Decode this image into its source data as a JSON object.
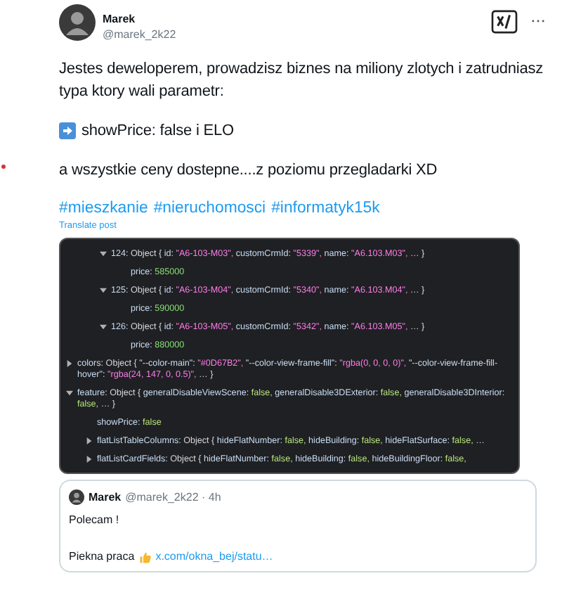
{
  "post": {
    "author": {
      "name": "Marek",
      "handle": "@marek_2k22"
    },
    "paragraphs": [
      {
        "kind": "text",
        "text": "Jestes deweloperem, prowadzisz biznes na miliony zlotych i zatrudniasz typa ktory wali parametr:"
      },
      {
        "kind": "arrow",
        "text": "showPrice: false i ELO"
      },
      {
        "kind": "text",
        "text": "a wszystkie ceny dostepne....z poziomu przegladarki XD"
      }
    ],
    "hashtags": [
      "#mieszkanie",
      "#nieruchomosci",
      "#informatyk15k"
    ],
    "translate": "Translate post",
    "devtools": {
      "array_items": [
        {
          "kind": "object",
          "expanded": true,
          "segments": [
            {
              "kind": "key",
              "text": "124:"
            },
            {
              "kind": "punct",
              "text": "Object {"
            },
            {
              "kind": "key",
              "text": "id:"
            },
            {
              "kind": "string",
              "text": "\"A6-103-M03\","
            },
            {
              "kind": "key",
              "text": "customCrmId:"
            },
            {
              "kind": "string",
              "text": "\"5339\","
            },
            {
              "kind": "key",
              "text": "name:"
            },
            {
              "kind": "string",
              "text": "\"A6.103.M03\","
            },
            {
              "kind": "punct",
              "text": "… }"
            }
          ],
          "children": [
            {
              "kind": "value",
              "segments": [
                {
                  "kind": "key",
                  "text": "price:"
                },
                {
                  "kind": "number",
                  "text": "585000"
                }
              ]
            }
          ]
        },
        {
          "kind": "object",
          "expanded": true,
          "segments": [
            {
              "kind": "key",
              "text": "125:"
            },
            {
              "kind": "punct",
              "text": "Object {"
            },
            {
              "kind": "key",
              "text": "id:"
            },
            {
              "kind": "string",
              "text": "\"A6-103-M04\","
            },
            {
              "kind": "key",
              "text": "customCrmId:"
            },
            {
              "kind": "string",
              "text": "\"5340\","
            },
            {
              "kind": "key",
              "text": "name:"
            },
            {
              "kind": "string",
              "text": "\"A6.103.M04\","
            },
            {
              "kind": "punct",
              "text": "… }"
            }
          ],
          "children": [
            {
              "kind": "value",
              "segments": [
                {
                  "kind": "key",
                  "text": "price:"
                },
                {
                  "kind": "number",
                  "text": "590000"
                }
              ]
            }
          ]
        },
        {
          "kind": "object",
          "expanded": true,
          "segments": [
            {
              "kind": "key",
              "text": "126:"
            },
            {
              "kind": "punct",
              "text": "Object {"
            },
            {
              "kind": "key",
              "text": "id:"
            },
            {
              "kind": "string",
              "text": "\"A6-103-M05\","
            },
            {
              "kind": "key",
              "text": "customCrmId:"
            },
            {
              "kind": "string",
              "text": "\"5342\","
            },
            {
              "kind": "key",
              "text": "name:"
            },
            {
              "kind": "string",
              "text": "\"A6.103.M05\","
            },
            {
              "kind": "punct",
              "text": "… }"
            }
          ],
          "children": [
            {
              "kind": "value",
              "segments": [
                {
                  "kind": "key",
                  "text": "price:"
                },
                {
                  "kind": "number",
                  "text": "880000"
                }
              ]
            }
          ]
        }
      ],
      "properties": [
        {
          "kind": "object",
          "expanded": false,
          "segments": [
            {
              "kind": "key",
              "text": "colors:"
            },
            {
              "kind": "punct",
              "text": "Object {"
            },
            {
              "kind": "key",
              "text": "\"--color-main\":"
            },
            {
              "kind": "string",
              "text": "\"#0D67B2\","
            },
            {
              "kind": "key",
              "text": "\"--color-view-frame-fill\":"
            },
            {
              "kind": "string",
              "text": "\"rgba(0, 0, 0, 0)\","
            },
            {
              "kind": "key",
              "text": "\"--color-view-frame-fill-hover\":"
            },
            {
              "kind": "string",
              "text": "\"rgba(24, 147, 0, 0.5)\","
            },
            {
              "kind": "punct",
              "text": "… }"
            }
          ]
        },
        {
          "kind": "object",
          "expanded": true,
          "segments": [
            {
              "kind": "key",
              "text": "feature:"
            },
            {
              "kind": "punct",
              "text": "Object {"
            },
            {
              "kind": "key",
              "text": "generalDisableViewScene:"
            },
            {
              "kind": "bool",
              "text": "false,"
            },
            {
              "kind": "key",
              "text": "generalDisable3DExterior:"
            },
            {
              "kind": "bool",
              "text": "false,"
            },
            {
              "kind": "key",
              "text": "generalDisable3DInterior:"
            },
            {
              "kind": "bool",
              "text": "false,"
            },
            {
              "kind": "punct",
              "text": "… }"
            }
          ],
          "children": [
            {
              "kind": "value",
              "segments": [
                {
                  "kind": "key",
                  "text": "showPrice:"
                },
                {
                  "kind": "bool",
                  "text": "false"
                }
              ]
            },
            {
              "kind": "object",
              "expanded": false,
              "segments": [
                {
                  "kind": "key",
                  "text": "flatListTableColumns:"
                },
                {
                  "kind": "punct",
                  "text": "Object {"
                },
                {
                  "kind": "key",
                  "text": "hideFlatNumber:"
                },
                {
                  "kind": "bool",
                  "text": "false,"
                },
                {
                  "kind": "key",
                  "text": "hideBuilding:"
                },
                {
                  "kind": "bool",
                  "text": "false,"
                },
                {
                  "kind": "key",
                  "text": "hideFlatSurface:"
                },
                {
                  "kind": "bool",
                  "text": "false,"
                },
                {
                  "kind": "punct",
                  "text": "…"
                }
              ]
            },
            {
              "kind": "object",
              "expanded": false,
              "segments": [
                {
                  "kind": "key",
                  "text": "flatListCardFields:"
                },
                {
                  "kind": "punct",
                  "text": "Object {"
                },
                {
                  "kind": "key",
                  "text": "hideFlatNumber:"
                },
                {
                  "kind": "bool",
                  "text": "false,"
                },
                {
                  "kind": "key",
                  "text": "hideBuilding:"
                },
                {
                  "kind": "bool",
                  "text": "false,"
                },
                {
                  "kind": "key",
                  "text": "hideBuildingFloor:"
                },
                {
                  "kind": "bool",
                  "text": "false,"
                }
              ]
            }
          ]
        }
      ]
    },
    "quote": {
      "name": "Marek",
      "byline": "@marek_2k22 · 4h",
      "lines": [
        {
          "kind": "text",
          "text": "Polecam !"
        },
        {
          "kind": "link",
          "text": "Piekna praca",
          "link": "x.com/okna_bej/statu…"
        }
      ]
    }
  }
}
